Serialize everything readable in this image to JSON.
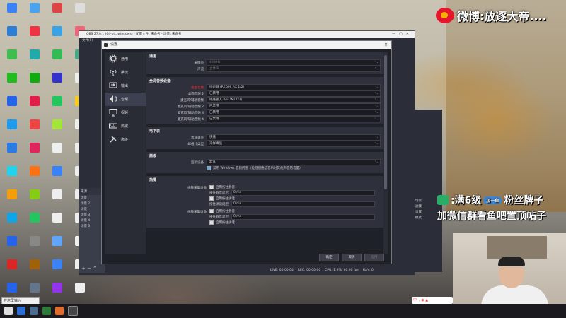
{
  "weibo": {
    "text": "微博:放逐大帝...."
  },
  "desktop_icons": [
    {
      "label": "",
      "color": "#3b82f6"
    },
    {
      "label": "",
      "color": "#4aa3f0"
    },
    {
      "label": "",
      "color": "#d44"
    },
    {
      "label": "",
      "color": "#ddd"
    },
    {
      "label": "",
      "color": "#2e7dd7"
    },
    {
      "label": "",
      "color": "#e34"
    },
    {
      "label": "",
      "color": "#3aa3e6"
    },
    {
      "label": "",
      "color": "#e67"
    },
    {
      "label": "",
      "color": "#3fbe4f"
    },
    {
      "label": "",
      "color": "#2aa"
    },
    {
      "label": "",
      "color": "#3b5"
    },
    {
      "label": "",
      "color": "#4a8"
    },
    {
      "label": "",
      "color": "#2b2"
    },
    {
      "label": "",
      "color": "#1a1"
    },
    {
      "label": "",
      "color": "#33c"
    },
    {
      "label": "",
      "color": "#eee"
    },
    {
      "label": "",
      "color": "#2563eb"
    },
    {
      "label": "",
      "color": "#e11d48"
    },
    {
      "label": "",
      "color": "#22c55e"
    },
    {
      "label": "",
      "color": "#facc15"
    },
    {
      "label": "",
      "color": "#1d9bf0"
    },
    {
      "label": "",
      "color": "#ef4444"
    },
    {
      "label": "",
      "color": "#a3e635"
    },
    {
      "label": "",
      "color": "#eee"
    },
    {
      "label": "",
      "color": "#2c7be5"
    },
    {
      "label": "",
      "color": "#e0245e"
    },
    {
      "label": "",
      "color": "#eee"
    },
    {
      "label": "",
      "color": "#eee"
    },
    {
      "label": "",
      "color": "#22d3ee"
    },
    {
      "label": "",
      "color": "#f97316"
    },
    {
      "label": "",
      "color": "#3b82f6"
    },
    {
      "label": "",
      "color": "#eee"
    },
    {
      "label": "",
      "color": "#f59e0b"
    },
    {
      "label": "",
      "color": "#84cc16"
    },
    {
      "label": "",
      "color": "#eee"
    },
    {
      "label": "",
      "color": "#eee"
    },
    {
      "label": "",
      "color": "#0ea5e9"
    },
    {
      "label": "",
      "color": "#22c55e"
    },
    {
      "label": "",
      "color": "#eee"
    },
    {
      "label": "",
      "color": "#eee"
    },
    {
      "label": "",
      "color": "#2563eb"
    },
    {
      "label": "",
      "color": "#888"
    },
    {
      "label": "",
      "color": "#60a5fa"
    },
    {
      "label": "",
      "color": "#eee"
    },
    {
      "label": "",
      "color": "#dc2626"
    },
    {
      "label": "",
      "color": "#a16207"
    },
    {
      "label": "",
      "color": "#3b82f6"
    },
    {
      "label": "",
      "color": "#eee"
    },
    {
      "label": "",
      "color": "#2563eb"
    },
    {
      "label": "",
      "color": "#64748b"
    },
    {
      "label": "",
      "color": "#9333ea"
    },
    {
      "label": "",
      "color": "#eee"
    }
  ],
  "obs": {
    "title": "OBS 27.0.1 (64-bit, windows) - 配置文件: 未命名 - 场景: 未命名",
    "menu": "文件(F)",
    "scenes_header": "来源",
    "scene_items": [
      "场景",
      "场景 2",
      "场景",
      "场景 3",
      "场景 4",
      "场景 3"
    ],
    "status": {
      "live": "LIVE: 00:00:04",
      "rec": "REC: 00:00:00",
      "cpu": "CPU: 1.9%, 60.00 fps",
      "kbps": "kb/s: 0"
    }
  },
  "settings": {
    "title": "设置",
    "nav": [
      {
        "label": "通用",
        "icon": "gear-icon",
        "active": false
      },
      {
        "label": "推流",
        "icon": "broadcast-icon",
        "active": false
      },
      {
        "label": "输出",
        "icon": "output-icon",
        "active": false
      },
      {
        "label": "音频",
        "icon": "speaker-icon",
        "active": true
      },
      {
        "label": "视频",
        "icon": "monitor-icon",
        "active": false
      },
      {
        "label": "热键",
        "icon": "keyboard-icon",
        "active": false
      },
      {
        "label": "高级",
        "icon": "tools-icon",
        "active": false
      }
    ],
    "sections": {
      "general": {
        "title": "通用",
        "rows": [
          {
            "label": "采样率",
            "value": "48 kHz",
            "dim": true
          },
          {
            "label": "声道",
            "value": "立体声",
            "dim": true
          }
        ]
      },
      "global_audio": {
        "title": "全局音频设备",
        "rows": [
          {
            "label": "桌面音频",
            "value": "扬声器 (REDMI AX 1/2)",
            "red": true
          },
          {
            "label": "桌面音频 2",
            "value": "已禁用"
          },
          {
            "label": "麦克风/辅助音频",
            "value": "线路输入 (REDMI 1/2)"
          },
          {
            "label": "麦克风/辅助音频 2",
            "value": "已禁用"
          },
          {
            "label": "麦克风/辅助音频 3",
            "value": "已禁用"
          },
          {
            "label": "麦克风/辅助音频 4",
            "value": "已禁用"
          }
        ]
      },
      "meters": {
        "title": "电平表",
        "rows": [
          {
            "label": "衰减速率",
            "value": "快速"
          },
          {
            "label": "峰值计类型",
            "value": "采样峰值"
          }
        ]
      },
      "advanced": {
        "title": "高级",
        "rows": [
          {
            "label": "监听设备",
            "value": "默认"
          }
        ],
        "checkbox": "禁用 Windows 音频闪避（拉低别通信音乐时其他声音的音量）"
      },
      "hotkeys": {
        "title": "热键",
        "groups": [
          {
            "label": "视频采集设备",
            "items": [
              {
                "type": "check",
                "text": "启用按住静音"
              },
              {
                "type": "key",
                "text": "按住静音延迟",
                "value": "0 ms"
              },
              {
                "type": "check",
                "text": "启用按住讲话"
              },
              {
                "type": "key",
                "text": "按住讲话延迟",
                "value": "0 ms"
              }
            ]
          },
          {
            "label": "视频采集设备",
            "items": [
              {
                "type": "check",
                "text": "启用按住静音"
              },
              {
                "type": "key",
                "text": "按住静音延迟",
                "value": "0 ms"
              },
              {
                "type": "check",
                "text": "启用按住讲话"
              }
            ]
          }
        ]
      }
    },
    "buttons": {
      "ok": "确定",
      "cancel": "取消",
      "apply": "应用"
    }
  },
  "side_panel": {
    "items": [
      "场景",
      "滤镜",
      "设置",
      "模式"
    ]
  },
  "wechat": {
    "line1": ":满6级",
    "badge": "加一鱼",
    "line1b": "粉丝牌子",
    "line2": "加微信群看鱼吧置顶帖子"
  },
  "taskbar": {
    "search": "在这里输入",
    "tray_text": "中 ·, ◉ ▲"
  }
}
